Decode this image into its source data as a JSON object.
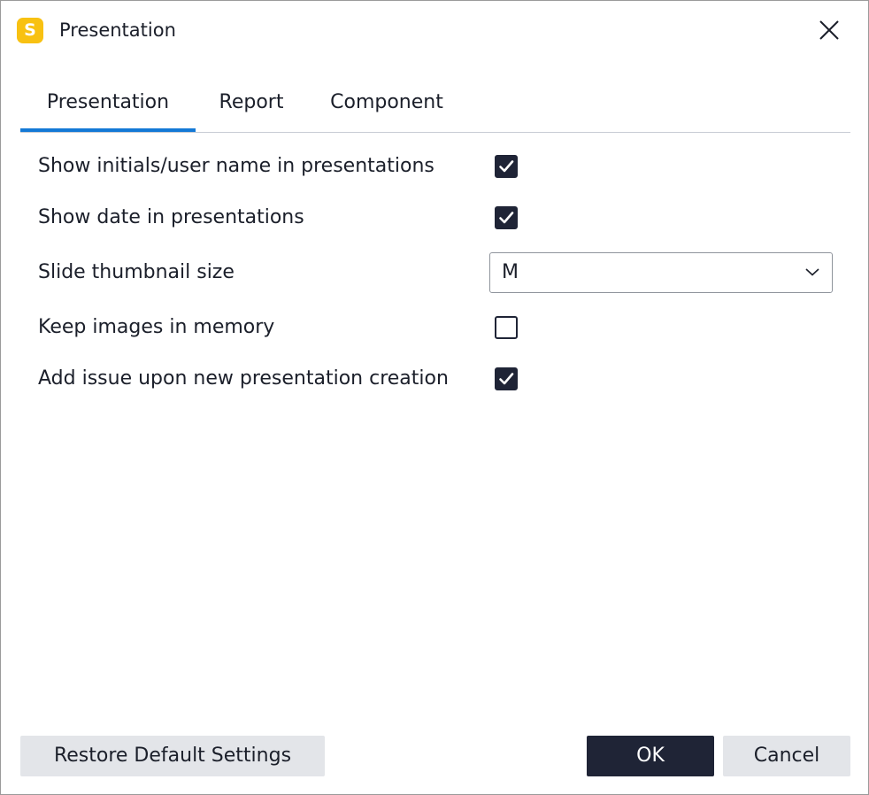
{
  "window": {
    "title": "Presentation",
    "app_icon_letter": "S",
    "accent_color": "#1479d6",
    "brand_color": "#f8c112",
    "close_icon": "close-icon"
  },
  "tabs": [
    {
      "label": "Presentation",
      "active": true
    },
    {
      "label": "Report",
      "active": false
    },
    {
      "label": "Component",
      "active": false
    }
  ],
  "settings": {
    "show_initials": {
      "label": "Show initials/user name in presentations",
      "checked": true
    },
    "show_date": {
      "label": "Show date in presentations",
      "checked": true
    },
    "thumbnail_size": {
      "label": "Slide thumbnail size",
      "value": "M"
    },
    "keep_images": {
      "label": "Keep images in memory",
      "checked": false
    },
    "add_issue": {
      "label": "Add issue upon new presentation creation",
      "checked": true
    }
  },
  "buttons": {
    "restore": "Restore Default Settings",
    "ok": "OK",
    "cancel": "Cancel"
  }
}
